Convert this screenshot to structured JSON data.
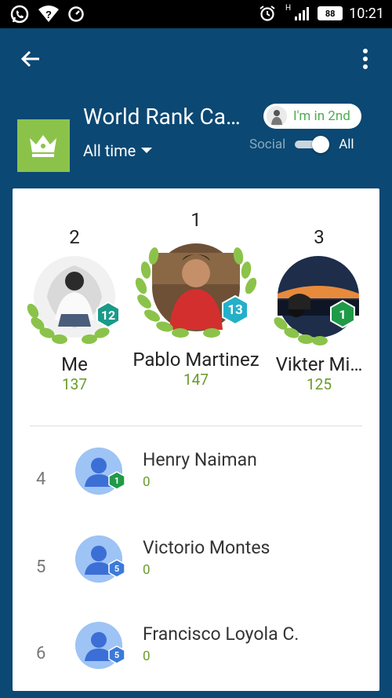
{
  "status_bar": {
    "time": "10:21",
    "battery": "88",
    "network": "H"
  },
  "header": {
    "title": "World Rank Ca…",
    "filter": "All time",
    "rank_pill": "I'm in 2nd",
    "toggle_left": "Social",
    "toggle_right": "All",
    "toggle_on": true
  },
  "podium": [
    {
      "position": "2",
      "name": "Me",
      "score": "137",
      "level": "12",
      "level_color": "#1a9a89"
    },
    {
      "position": "1",
      "name": "Pablo Martinez",
      "score": "147",
      "level": "13",
      "level_color": "#23b0c9"
    },
    {
      "position": "3",
      "name": "Vikter Mi…",
      "score": "125",
      "level": "1",
      "level_color": "#1f9a48"
    }
  ],
  "list": [
    {
      "position": "4",
      "name": "Henry Naiman",
      "score": "0",
      "level": "1",
      "level_color": "#1f9a48"
    },
    {
      "position": "5",
      "name": "Victorio Montes",
      "score": "0",
      "level": "5",
      "level_color": "#3b7ad9"
    },
    {
      "position": "6",
      "name": "Francisco Loyola C.",
      "score": "0",
      "level": "5",
      "level_color": "#3b7ad9"
    }
  ],
  "colors": {
    "app_bg": "#0b4873",
    "accent_green": "#8bc34a",
    "score_green": "#6a9b2a"
  }
}
